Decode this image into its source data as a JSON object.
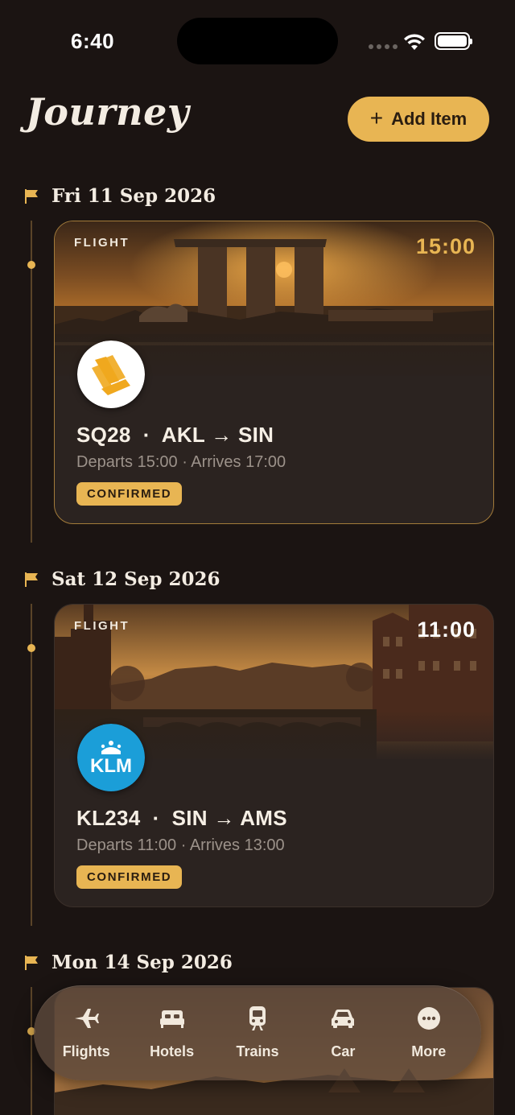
{
  "status_bar": {
    "time": "6:40"
  },
  "header": {
    "title": "Journey",
    "add_button_label": "Add Item"
  },
  "days": [
    {
      "label": "Fri 11 Sep 2026"
    },
    {
      "label": "Sat 12 Sep 2026"
    },
    {
      "label": "Mon 14 Sep 2026"
    }
  ],
  "cards": [
    {
      "type": "FLIGHT",
      "time": "15:00",
      "time_color": "#e8b553",
      "title": "SQ28  ·  AKL → SIN",
      "subtitle": "Departs 15:00 · Arrives 17:00",
      "status": "CONFIRMED",
      "airline_logo": "singapore-airlines-logo"
    },
    {
      "type": "FLIGHT",
      "time": "11:00",
      "time_color": "#ffffff",
      "title": "KL234  ·  SIN → AMS",
      "subtitle": "Departs 11:00 · Arrives 13:00",
      "status": "CONFIRMED",
      "airline_logo": "klm-logo"
    }
  ],
  "tab_bar": {
    "tabs": [
      {
        "label": "Flights",
        "icon": "airplane-icon"
      },
      {
        "label": "Hotels",
        "icon": "bed-icon"
      },
      {
        "label": "Trains",
        "icon": "train-icon"
      },
      {
        "label": "Car",
        "icon": "car-icon"
      },
      {
        "label": "More",
        "icon": "more-icon"
      }
    ]
  },
  "colors": {
    "background": "#1b1412",
    "accent": "#e8b553",
    "card": "#2b2320"
  }
}
